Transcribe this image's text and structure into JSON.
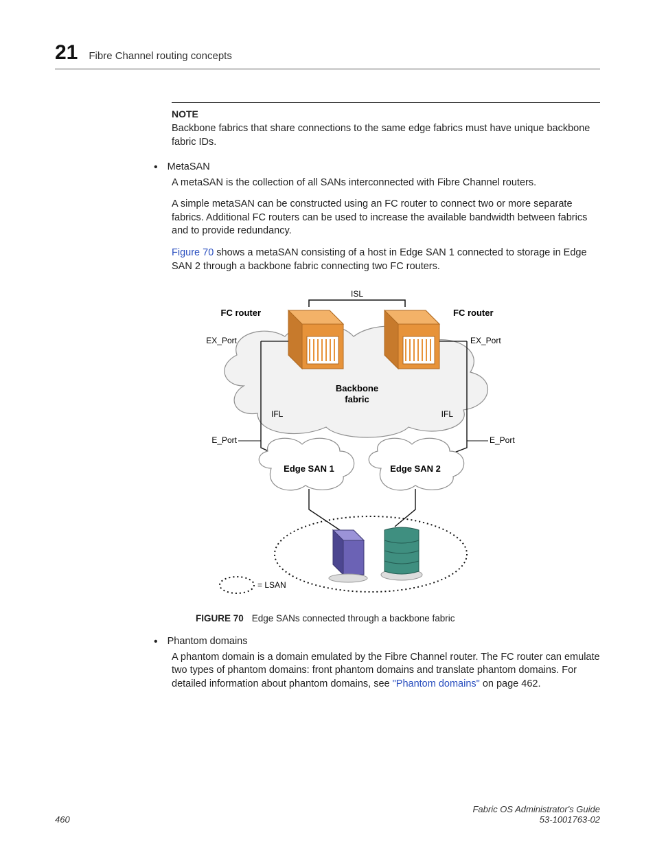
{
  "header": {
    "chapter_number": "21",
    "chapter_title": "Fibre Channel routing concepts"
  },
  "note": {
    "label": "NOTE",
    "text": "Backbone fabrics that share connections to the same edge fabrics must have unique backbone fabric IDs."
  },
  "bullets": {
    "metasan": {
      "term": "MetaSAN",
      "p1": "A metaSAN is the collection of all SANs interconnected with Fibre Channel routers.",
      "p2": "A simple metaSAN can be constructed using an FC router to connect two or more separate fabrics. Additional FC routers can be used to increase the available bandwidth between fabrics and to provide redundancy.",
      "p3_link": "Figure 70",
      "p3_rest": " shows a metaSAN consisting of a host in Edge SAN 1 connected to storage in Edge SAN 2 through a backbone fabric connecting two FC routers."
    },
    "phantom": {
      "term": "Phantom domains",
      "p1a": "A phantom domain is a domain emulated by the Fibre Channel router. The FC router can emulate two types of phantom domains: front phantom domains and translate phantom domains. For detailed information about phantom domains, see ",
      "p1_link": "\"Phantom domains\"",
      "p1b": " on page 462."
    }
  },
  "figure": {
    "number": "FIGURE 70",
    "caption": "Edge SANs connected through a backbone fabric",
    "labels": {
      "fc_router_l": "FC router",
      "fc_router_r": "FC router",
      "isl": "ISL",
      "ex_port_l": "EX_Port",
      "ex_port_r": "EX_Port",
      "backbone": "Backbone",
      "fabric": "fabric",
      "ifl_l": "IFL",
      "ifl_r": "IFL",
      "e_port_l": "E_Port",
      "e_port_r": "E_Port",
      "edge1": "Edge SAN 1",
      "edge2": "Edge SAN 2",
      "lsan": "= LSAN"
    }
  },
  "footer": {
    "page": "460",
    "guide": "Fabric OS Administrator's Guide",
    "doc_id": "53-1001763-02"
  }
}
